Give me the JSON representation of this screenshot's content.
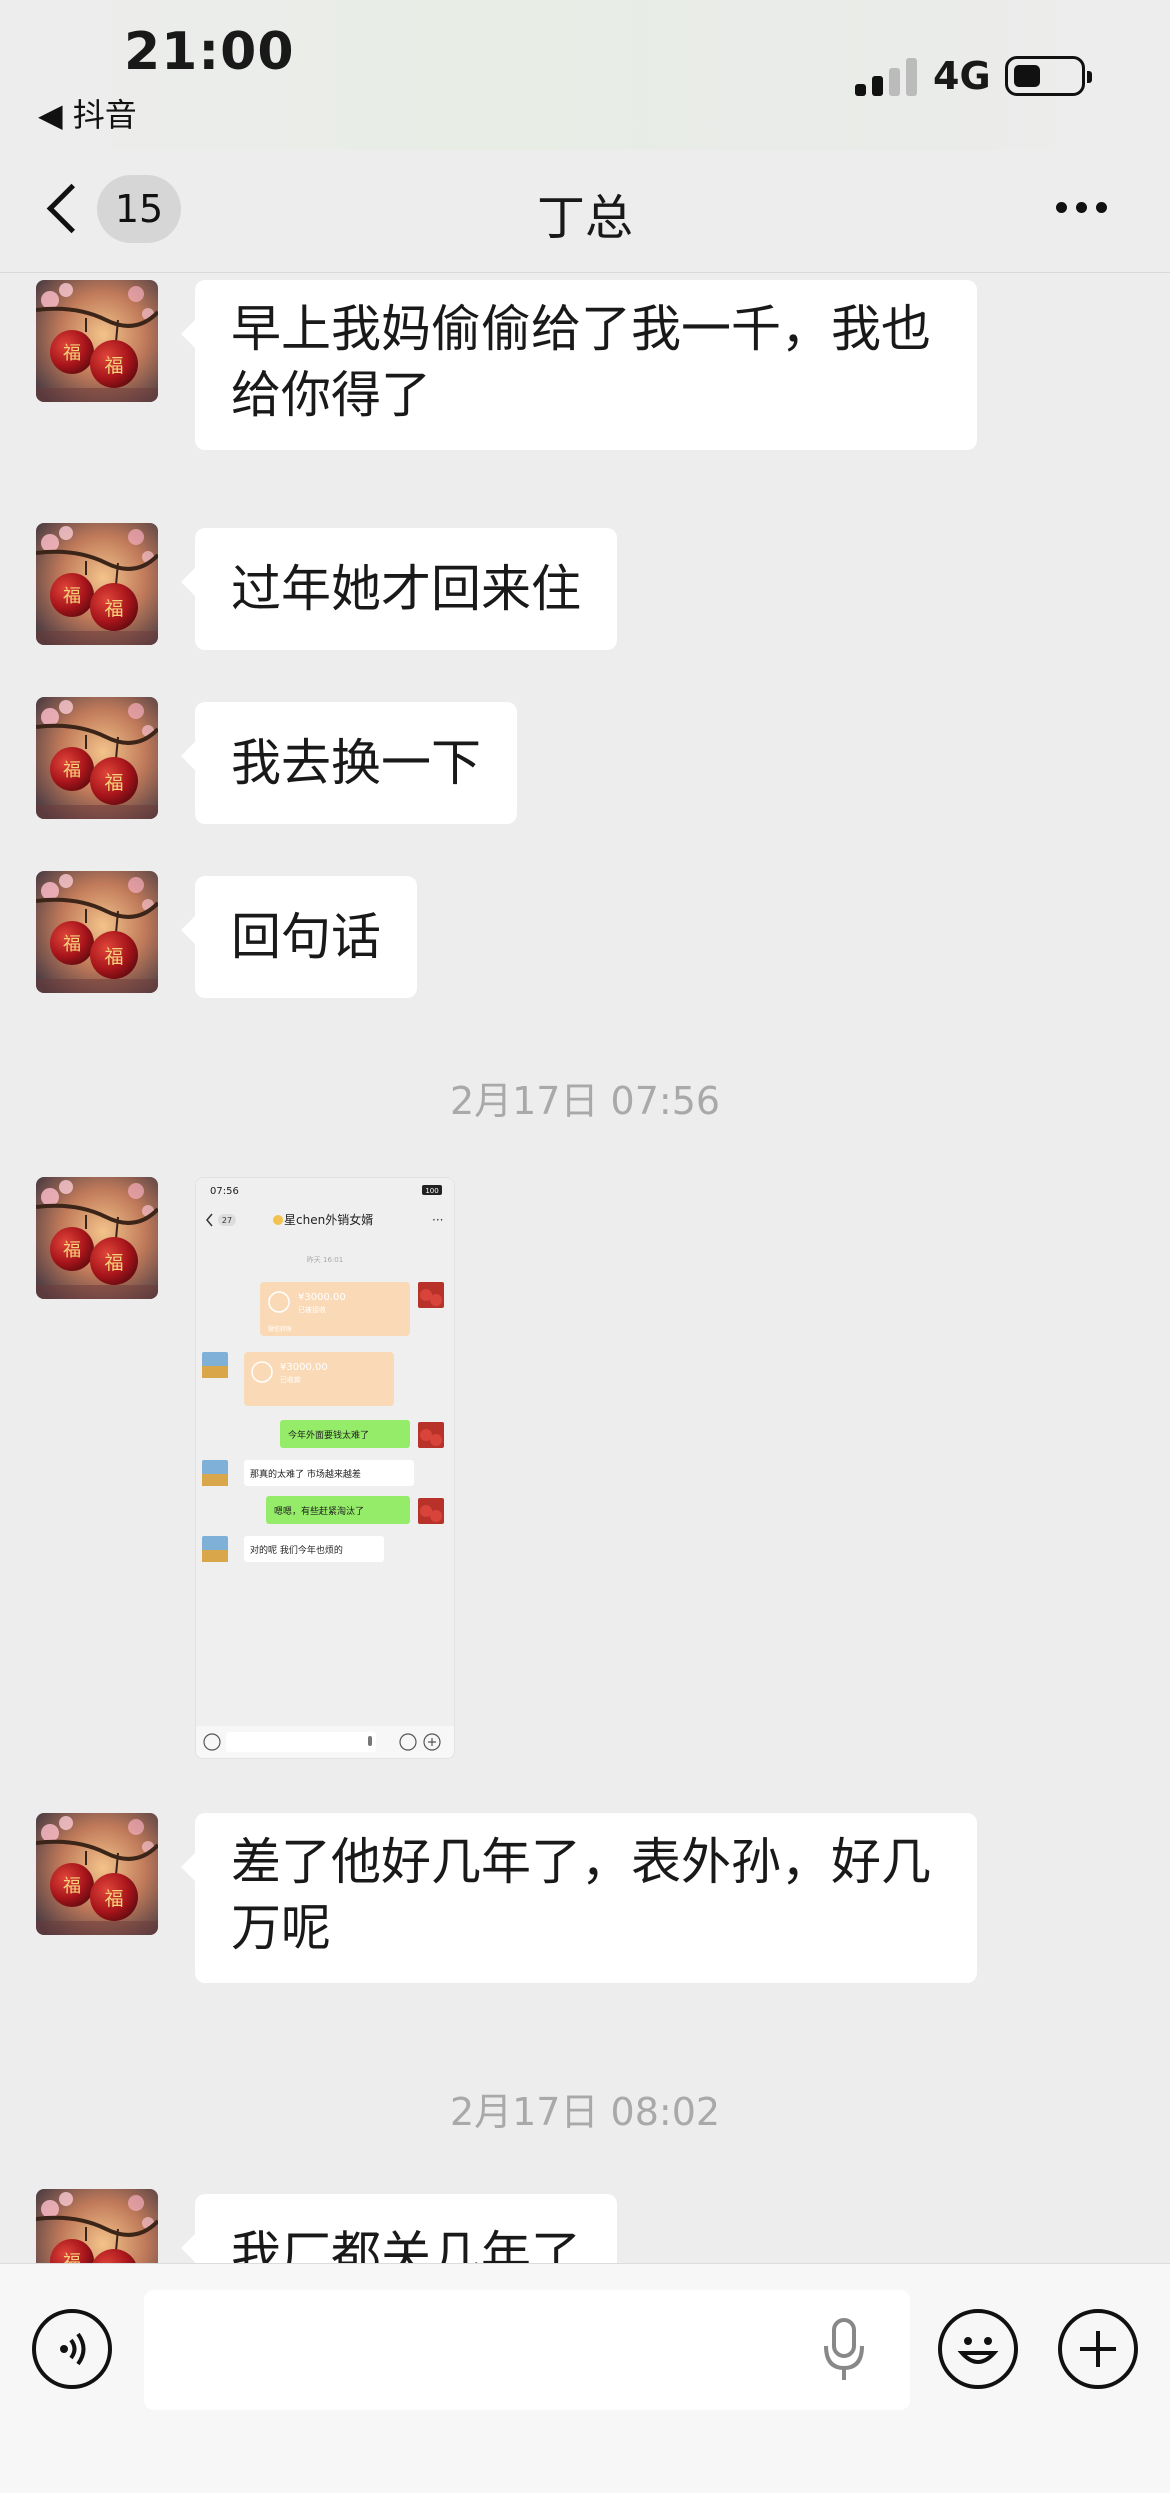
{
  "status_bar": {
    "time": "21:00",
    "back_app": "◀ 抖音",
    "network": "4G",
    "signal_bars": 2,
    "battery_level": 0.35
  },
  "nav": {
    "unread_count": "15",
    "title": "丁总"
  },
  "messages": [
    {
      "type": "text",
      "text": "早上我妈偷偷给了我一千，我也给你得了"
    },
    {
      "type": "text",
      "text": "过年她才回来住"
    },
    {
      "type": "text",
      "text": "我去换一下"
    },
    {
      "type": "text",
      "text": "回句话"
    },
    {
      "type": "time",
      "text": "2月17日 07:56"
    },
    {
      "type": "image",
      "screenshot": {
        "time": "07:56",
        "battery": "100",
        "back_count": "27",
        "title": "星chen外销女婿",
        "date": "昨天 16:01",
        "transfer1_amount": "¥3000.00",
        "transfer1_status": "已被接收",
        "transfer1_note": "微信转账",
        "transfer2_amount": "¥3000.00",
        "transfer2_status": "已收款",
        "msg1": "今年外面要钱太难了",
        "msg2": "那真的太难了 市场越来越差",
        "msg3": "嗯嗯，有些赶紧淘汰了",
        "msg4": "对的呢 我们今年也烦的"
      }
    },
    {
      "type": "text",
      "text": "差了他好几年了，表外孙，好几万呢"
    },
    {
      "type": "time",
      "text": "2月17日 08:02"
    },
    {
      "type": "text",
      "text": "我厂都关几年了"
    }
  ],
  "colors": {
    "background": "#ededed",
    "bubble": "#ffffff",
    "green_bubble": "#95ec69",
    "transfer": "#fad9b6",
    "timestamp": "#a9a9a9"
  },
  "icons": [
    "voice-icon",
    "microphone-icon",
    "emoji-icon",
    "plus-icon",
    "back-chevron-icon",
    "more-icon"
  ]
}
